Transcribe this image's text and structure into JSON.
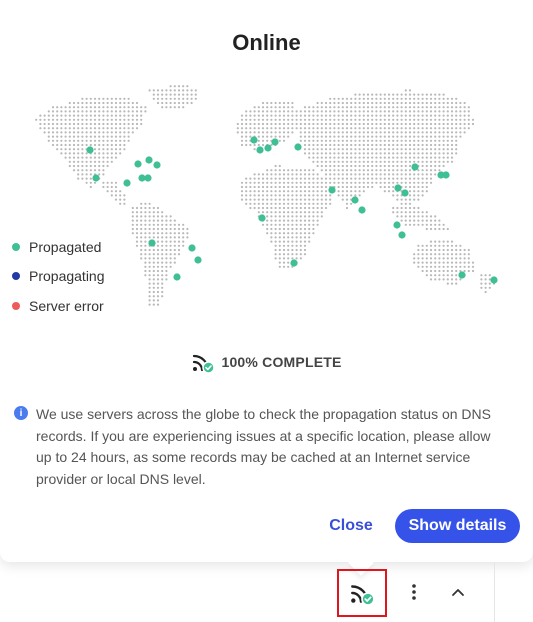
{
  "popup": {
    "title": "Online",
    "legend": [
      {
        "label": "Propagated",
        "color": "#3fbf95"
      },
      {
        "label": "Propagating",
        "color": "#233aa6"
      },
      {
        "label": "Server error",
        "color": "#ef5a5a"
      }
    ],
    "status_label": "100% COMPLETE",
    "info_text": "We use servers across the globe to check the propagation status on DNS records. If you are experiencing issues at a specific location, please allow up to 24 hours, as some records may be cached at an Internet service provider or local DNS level.",
    "close_label": "Close",
    "details_label": "Show details"
  },
  "toolbar": {
    "dns_icon": "dns-propagation-icon",
    "more_icon": "more-vertical-icon",
    "collapse_icon": "chevron-up-icon"
  },
  "colors": {
    "accent": "#3553e8",
    "propagated": "#3fbf95",
    "highlight_border": "#e0161e"
  }
}
